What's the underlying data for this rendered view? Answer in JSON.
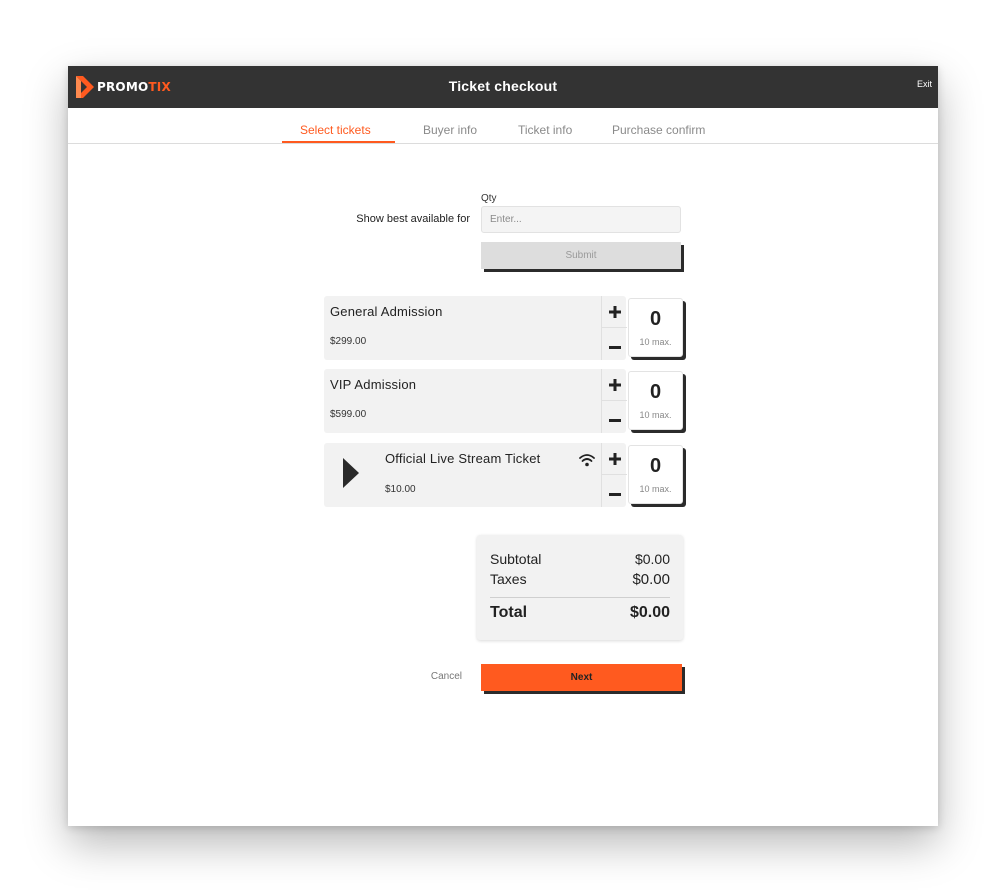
{
  "header": {
    "logo_text_primary": "PROMO",
    "logo_text_accent": "TIX",
    "title": "Ticket checkout",
    "exit_label": "Exit"
  },
  "steps": [
    {
      "label": "Select tickets",
      "active": true
    },
    {
      "label": "Buyer info",
      "active": false
    },
    {
      "label": "Ticket info",
      "active": false
    },
    {
      "label": "Purchase confirm",
      "active": false
    }
  ],
  "best_available": {
    "qty_label": "Qty",
    "prompt": "Show best available for",
    "placeholder": "Enter...",
    "value": "",
    "submit_label": "Submit"
  },
  "tickets": [
    {
      "name": "General Admission",
      "price": "$299.00",
      "count": "0",
      "max_label": "10 max.",
      "icon": null
    },
    {
      "name": "VIP Admission",
      "price": "$599.00",
      "count": "0",
      "max_label": "10 max.",
      "icon": null
    },
    {
      "name": "Official Live Stream Ticket",
      "price": "$10.00",
      "count": "0",
      "max_label": "10 max.",
      "icon": "wifi-icon",
      "leading_icon": "play-icon"
    }
  ],
  "stepper": {
    "plus_icon": "plus-icon",
    "minus_icon": "minus-icon"
  },
  "totals": {
    "subtotal_label": "Subtotal",
    "subtotal_value": "$0.00",
    "taxes_label": "Taxes",
    "taxes_value": "$0.00",
    "total_label": "Total",
    "total_value": "$0.00"
  },
  "actions": {
    "cancel_label": "Cancel",
    "next_label": "Next"
  },
  "colors": {
    "accent": "#ff5a1f",
    "header_bg": "#333333",
    "card_bg": "#f2f2f2"
  }
}
